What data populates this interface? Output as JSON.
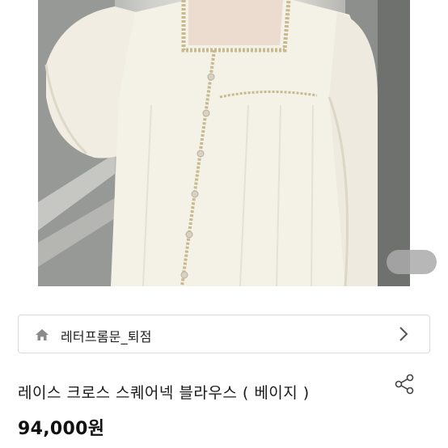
{
  "product": {
    "store_name": "레터프롬문_퇴점",
    "title": "레이스 크로스 스퀘어넥 블라우스 ( 베이지 )",
    "price": "94,000원"
  },
  "icons": {
    "store": "home-icon",
    "store_link": "chevron-right-icon",
    "share": "share-icon"
  },
  "colors": {
    "blouse": "#f3efe3",
    "lace_trim": "#c8b98e",
    "pager": "#aaaaaa"
  }
}
